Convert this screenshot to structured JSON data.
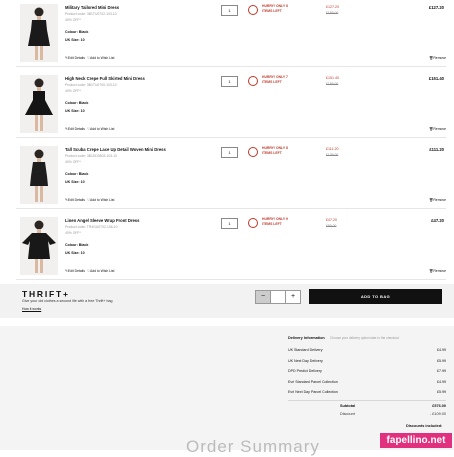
{
  "items": [
    {
      "title": "Military Tailored Mini Dress",
      "code": "Product code: 3B1TU0702-103-10",
      "save": "40% OFF*",
      "colour": "Colour: Black",
      "size": "UK Size: 10",
      "edit": "Edit Details",
      "wishlist": "Add to Wish List",
      "qty": "1",
      "hurry": [
        "HURRY! ONLY 8",
        "ITEMS LEFT"
      ],
      "price": "£127.20",
      "was": "£159.00",
      "total": "£127.20",
      "remove": "Remove"
    },
    {
      "title": "High Neck Crepe Full Skirted Mini Dress",
      "code": "Product code: 3B1TU0700-103-10",
      "save": "40% OFF*",
      "colour": "Colour: Black",
      "size": "UK Size: 10",
      "edit": "Edit Details",
      "wishlist": "Add to Wish List",
      "qty": "1",
      "hurry": [
        "HURRY! ONLY 7",
        "ITEMS LEFT"
      ],
      "price": "£151.40",
      "was": "£189.00",
      "total": "£151.40",
      "remove": "Remove"
    },
    {
      "title": "Tall Scuba Crepe Lace Up Detail Woven Mini Dress",
      "code": "Product code: 3B1DD0803-103-10",
      "save": "40% OFF*",
      "colour": "Colour: Black",
      "size": "UK Size: 10",
      "edit": "Edit Details",
      "wishlist": "Add to Wish List",
      "qty": "1",
      "hurry": [
        "HURRY! ONLY 8",
        "ITEMS LEFT"
      ],
      "price": "£111.20",
      "was": "£139.00",
      "total": "£111.20",
      "remove": "Remove"
    },
    {
      "title": "Linen Angel Sleeve Wrap Front Dress",
      "code": "Product code: TR4GU0702-106-10",
      "save": "40% OFF*",
      "colour": "Colour: Black",
      "size": "UK Size: 10",
      "edit": "Edit Details",
      "wishlist": "Add to Wish List",
      "qty": "1",
      "hurry": [
        "HURRY! ONLY 9",
        "ITEMS LEFT"
      ],
      "price": "£47.20",
      "was": "£59.00",
      "total": "£47.20",
      "remove": "Remove"
    }
  ],
  "thrift": {
    "logo": "THRIFT+",
    "description": "Give your old clothes a second life with a free Thrift+ bag",
    "link": "How it works",
    "minus": "−",
    "plus": "+",
    "add_to_bag": "ADD TO BAG"
  },
  "delivery": {
    "heading": "Delivery Information",
    "hint": "Choose your delivery option later in the checkout",
    "options": [
      {
        "name": "UK Standard Delivery",
        "price": "£4.99"
      },
      {
        "name": "UK Next Day Delivery",
        "price": "£5.99"
      },
      {
        "name": "DPD Predict Delivery",
        "price": "£7.99"
      },
      {
        "name": "Evri Standard Parcel Collection",
        "price": "£4.99"
      },
      {
        "name": "Evri Next Day Parcel Collection",
        "price": "£5.99"
      }
    ]
  },
  "totals": {
    "subtotal_label": "Subtotal",
    "subtotal": "£576.00",
    "discount_label": "Discount",
    "discount": "- £109.00",
    "discounts_included": "Discounts included:"
  },
  "footer_heading": "Order Summary",
  "watermark": "fapellino.net",
  "colors": {
    "sale_red": "#c0392b",
    "button_black": "#111111",
    "watermark_pink": "#e0307e"
  }
}
